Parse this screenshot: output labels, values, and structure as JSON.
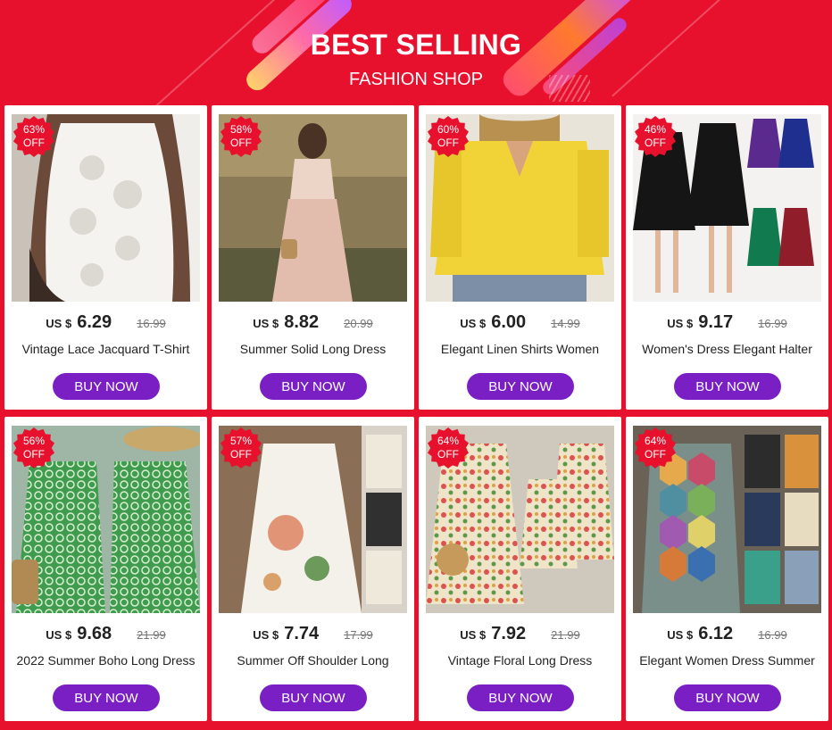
{
  "banner": {
    "title": "BEST SELLING",
    "subtitle": "FASHION SHOP",
    "background_color": "#e8112d"
  },
  "accent": {
    "badge": "#e8112d",
    "button": "#7a1fc4"
  },
  "products": [
    {
      "discount": "63%",
      "off": "OFF",
      "currency": "US $",
      "price": "6.29",
      "old_price": "16.99",
      "name": "Vintage Lace Jacquard T-Shirt",
      "cta": "BUY NOW",
      "image": "white-lace-top"
    },
    {
      "discount": "58%",
      "off": "OFF",
      "currency": "US $",
      "price": "8.82",
      "old_price": "20.99",
      "name": "Summer Solid Long Dress",
      "cta": "BUY NOW",
      "image": "pink-long-dress"
    },
    {
      "discount": "60%",
      "off": "OFF",
      "currency": "US $",
      "price": "6.00",
      "old_price": "14.99",
      "name": "Elegant Linen Shirts Women",
      "cta": "BUY NOW",
      "image": "yellow-linen-shirt"
    },
    {
      "discount": "46%",
      "off": "OFF",
      "currency": "US $",
      "price": "9.17",
      "old_price": "16.99",
      "name": "Women's Dress Elegant Halter",
      "cta": "BUY NOW",
      "image": "halter-dress-colors"
    },
    {
      "discount": "56%",
      "off": "OFF",
      "currency": "US $",
      "price": "9.68",
      "old_price": "21.99",
      "name": "2022 Summer Boho Long Dress",
      "cta": "BUY NOW",
      "image": "green-boho-dress"
    },
    {
      "discount": "57%",
      "off": "OFF",
      "currency": "US $",
      "price": "7.74",
      "old_price": "17.99",
      "name": "Summer Off Shoulder Long",
      "cta": "BUY NOW",
      "image": "white-floral-off-shoulder"
    },
    {
      "discount": "64%",
      "off": "OFF",
      "currency": "US $",
      "price": "7.92",
      "old_price": "21.99",
      "name": "Vintage Floral Long Dress",
      "cta": "BUY NOW",
      "image": "beige-floral-dress"
    },
    {
      "discount": "64%",
      "off": "OFF",
      "currency": "US $",
      "price": "6.12",
      "old_price": "16.99",
      "name": "Elegant Women Dress Summer",
      "cta": "BUY NOW",
      "image": "geometric-print-dress"
    }
  ]
}
